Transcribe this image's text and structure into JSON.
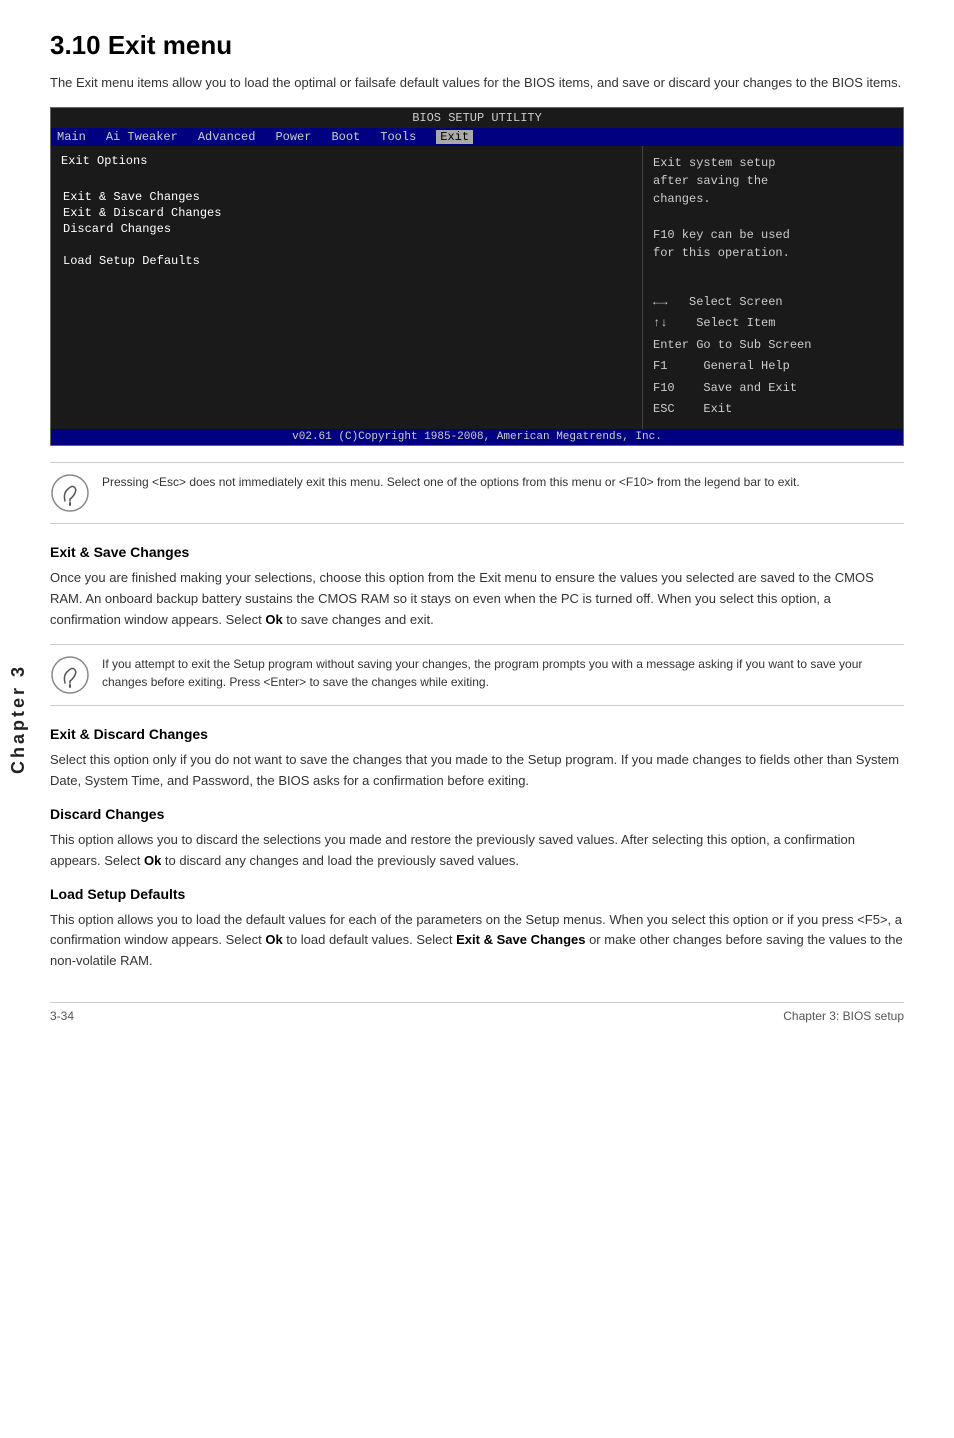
{
  "page": {
    "title": "3.10   Exit menu",
    "intro": "The Exit menu items allow you to load the optimal or failsafe default values for the BIOS items, and save or discard your changes to the BIOS items."
  },
  "bios": {
    "title": "BIOS SETUP UTILITY",
    "menu_items": [
      "Main",
      "Ai Tweaker",
      "Advanced",
      "Power",
      "Boot",
      "Tools",
      "Exit"
    ],
    "active_tab": "Exit",
    "left_panel": {
      "section_title": "Exit Options",
      "entries": [
        "Exit & Save Changes",
        "Exit & Discard Changes",
        "Discard Changes",
        "",
        "Load Setup Defaults"
      ]
    },
    "right_panel": {
      "help_text": "Exit system setup\nafter saving the\nchanges.\n\nF10 key can be used\nfor this operation.",
      "legend": [
        {
          "key": "←→",
          "action": "Select Screen"
        },
        {
          "key": "↑↓",
          "action": "Select Item"
        },
        {
          "key": "Enter",
          "action": "Go to Sub Screen"
        },
        {
          "key": "F1",
          "action": "General Help"
        },
        {
          "key": "F10",
          "action": "Save and Exit"
        },
        {
          "key": "ESC",
          "action": "Exit"
        }
      ]
    },
    "footer": "v02.61  (C)Copyright 1985-2008, American Megatrends, Inc."
  },
  "note1": {
    "text": "Pressing <Esc> does not immediately exit this menu. Select one of the options from this menu or <F10> from the legend bar to exit."
  },
  "note2": {
    "text": "If you attempt to exit the Setup program without saving your changes, the program prompts you with a message asking if you want to save your changes before exiting. Press <Enter> to save the changes while exiting."
  },
  "sections": [
    {
      "id": "exit-save",
      "heading": "Exit & Save Changes",
      "body": "Once you are finished making your selections, choose this option from the Exit menu to ensure the values you selected are saved to the CMOS RAM. An onboard backup battery sustains the CMOS RAM so it stays on even when the PC is turned off. When you select this option, a confirmation window appears. Select <strong>Ok</strong> to save changes and exit."
    },
    {
      "id": "exit-discard",
      "heading": "Exit & Discard Changes",
      "body": "Select this option only if you do not want to save the changes that you  made to the Setup program. If you made changes to fields other than System Date, System Time, and Password, the BIOS asks for a confirmation before exiting."
    },
    {
      "id": "discard-changes",
      "heading": "Discard Changes",
      "body": "This option allows you to discard the selections you made and restore the previously saved values. After selecting this option, a confirmation appears. Select <strong>Ok</strong> to discard any changes and load the previously saved values."
    },
    {
      "id": "load-defaults",
      "heading": "Load Setup Defaults",
      "body": "This option allows you to load the default values for each of the parameters on the Setup menus. When you select this option or if you press <F5>, a confirmation window appears. Select <strong>Ok</strong> to load default values. Select <strong>Exit & Save Changes</strong> or make other changes before saving the values to the non-volatile RAM."
    }
  ],
  "footer": {
    "left": "3-34",
    "right": "Chapter 3: BIOS setup"
  },
  "chapter_label": "Chapter 3"
}
